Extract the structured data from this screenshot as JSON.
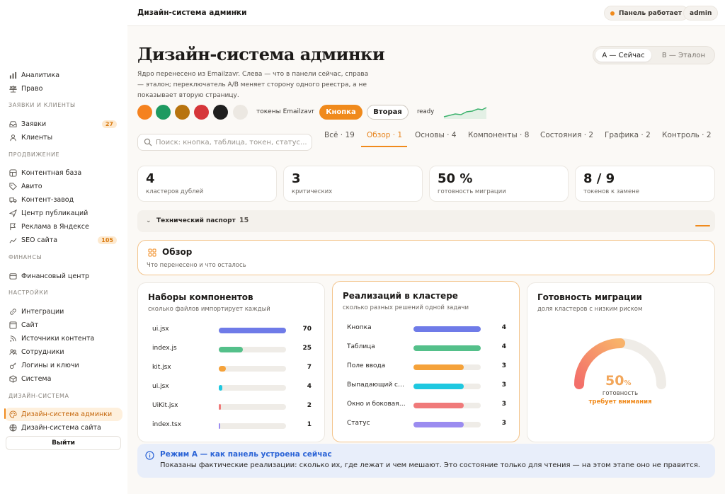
{
  "sidebar": {
    "top_items": [
      {
        "label": "Аналитика",
        "icon": "chart-icon"
      },
      {
        "label": "Право",
        "icon": "scales-icon"
      }
    ],
    "sections": [
      {
        "title": "ЗАЯВКИ И КЛИЕНТЫ",
        "items": [
          {
            "label": "Заявки",
            "icon": "inbox-icon",
            "badge": "27"
          },
          {
            "label": "Клиенты",
            "icon": "users-icon"
          }
        ]
      },
      {
        "title": "ПРОДВИЖЕНИЕ",
        "items": [
          {
            "label": "Контентная база",
            "icon": "grid-icon"
          },
          {
            "label": "Авито",
            "icon": "tag-icon"
          },
          {
            "label": "Контент-завод",
            "icon": "truck-icon"
          },
          {
            "label": "Центр публикаций",
            "icon": "send-icon"
          },
          {
            "label": "Реклама в Яндексе",
            "icon": "flag-icon"
          },
          {
            "label": "SEO сайта",
            "icon": "trend-icon",
            "badge": "105"
          }
        ]
      },
      {
        "title": "ФИНАНСЫ",
        "items": [
          {
            "label": "Финансовый центр",
            "icon": "wallet-icon"
          }
        ]
      },
      {
        "title": "НАСТРОЙКИ",
        "items": [
          {
            "label": "Интеграции",
            "icon": "link-icon"
          },
          {
            "label": "Сайт",
            "icon": "layout-icon"
          },
          {
            "label": "Источники контента",
            "icon": "rss-icon"
          },
          {
            "label": "Сотрудники",
            "icon": "team-icon"
          },
          {
            "label": "Логины и ключи",
            "icon": "key-icon"
          },
          {
            "label": "Система",
            "icon": "box-icon"
          }
        ]
      },
      {
        "title": "ДИЗАЙН-СИСТЕМА",
        "items": [
          {
            "label": "Дизайн-система админки",
            "icon": "palette-icon",
            "active": true
          },
          {
            "label": "Дизайн-система сайта",
            "icon": "globe-icon"
          }
        ]
      }
    ],
    "logout_label": "Выйти"
  },
  "topbar": {
    "title": "Дизайн-система админки",
    "help": "?",
    "status_label": "Панель работает",
    "user_label": "admin"
  },
  "header": {
    "title": "Дизайн-система админки",
    "lead": "Ядро перенесено из Emailzavr. Слева — что в панели сейчас, справа — эталон; переключатель А/В меняет сторону одного реестра, а не показывает вторую страницу.",
    "toggle": {
      "a": "А — Сейчас",
      "b": "В — Эталон"
    }
  },
  "tokens": {
    "swatches": [
      "#f5821f",
      "#1e9a61",
      "#b8740f",
      "#d6363a",
      "#1f1f1f",
      "#ece8e2"
    ],
    "label": "токены Emailzavr",
    "primary_label": "Кнопка",
    "secondary_label": "Вторая",
    "ready_label": "ready",
    "spark_color": "#3bb26c"
  },
  "search": {
    "placeholder": "Поиск: кнопка, таблица, токен, статус..."
  },
  "tabs": [
    {
      "label": "Всё · 19"
    },
    {
      "label": "Обзор · 1",
      "active": true
    },
    {
      "label": "Основы · 4"
    },
    {
      "label": "Компоненты · 8"
    },
    {
      "label": "Состояния · 2"
    },
    {
      "label": "Графика · 2"
    },
    {
      "label": "Контроль · 2"
    }
  ],
  "stats": [
    {
      "value": "4",
      "label": "кластеров дублей"
    },
    {
      "value": "3",
      "label": "критических"
    },
    {
      "value": "50 %",
      "label": "готовность миграции"
    },
    {
      "value": "8 / 9",
      "label": "токенов к замене"
    }
  ],
  "passport": {
    "chevron": "⌄",
    "title": "Технический паспорт",
    "count": "15"
  },
  "overview": {
    "title": "Обзор",
    "subtitle": "Что перенесено и что осталось"
  },
  "card_sets": {
    "title": "Наборы компонентов",
    "subtitle": "сколько файлов импортирует каждый",
    "max": 70,
    "rows": [
      {
        "label": "ui.jsx",
        "value": 70,
        "color": "#6f7be8"
      },
      {
        "label": "index.js",
        "value": 25,
        "color": "#54c08a"
      },
      {
        "label": "kit.jsx",
        "value": 7,
        "color": "#f5a23a"
      },
      {
        "label": "ui.jsx",
        "value": 4,
        "color": "#1fc8e0"
      },
      {
        "label": "UiKit.jsx",
        "value": 2,
        "color": "#f07a7a"
      },
      {
        "label": "index.tsx",
        "value": 1,
        "color": "#9b8cf0"
      }
    ]
  },
  "card_impl": {
    "title": "Реализаций в кластере",
    "subtitle": "сколько разных решений одной задачи",
    "max": 4,
    "rows": [
      {
        "label": "Кнопка",
        "value": 4,
        "color": "#6f7be8"
      },
      {
        "label": "Таблица",
        "value": 4,
        "color": "#54c08a"
      },
      {
        "label": "Поле ввода",
        "value": 3,
        "color": "#f5a23a"
      },
      {
        "label": "Выпадающий сп...",
        "value": 3,
        "color": "#1fc8e0"
      },
      {
        "label": "Окно и боковая ...",
        "value": 3,
        "color": "#f07a7a"
      },
      {
        "label": "Статус",
        "value": 3,
        "color": "#9b8cf0"
      }
    ]
  },
  "card_ready": {
    "title": "Готовность миграции",
    "subtitle": "доля кластеров с низким риском",
    "value": 50,
    "value_text": "50",
    "unit": "%",
    "caption": "готовность",
    "status": "требует внимания"
  },
  "info": {
    "title": "Режим А — как панель устроена сейчас",
    "text": "Показаны фактические реализации: сколько их, где лежат и чем мешают. Это состояние только для чтения — на этом этапе оно не правится."
  }
}
